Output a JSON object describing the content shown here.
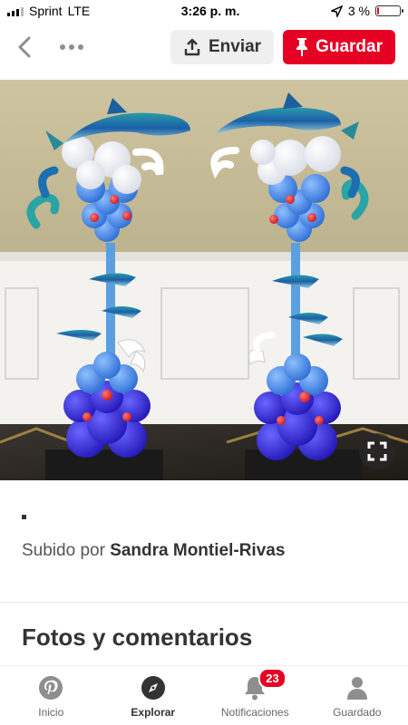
{
  "status_bar": {
    "carrier": "Sprint",
    "network": "LTE",
    "time": "3:26 p. m.",
    "battery_text": "3 %",
    "battery_level": 0.03
  },
  "top_bar": {
    "share_label": "Enviar",
    "save_label": "Guardar"
  },
  "pin": {
    "dot": "·",
    "uploaded_by_prefix": "Subido por",
    "uploader_name": "Sandra Montiel-Rivas",
    "comments_title": "Fotos y comentarios"
  },
  "bottom_nav": {
    "items": [
      {
        "label": "Inicio",
        "icon": "pinterest-icon"
      },
      {
        "label": "Explorar",
        "icon": "compass-icon"
      },
      {
        "label": "Notificaciones",
        "icon": "bell-icon",
        "badge": "23"
      },
      {
        "label": "Guardado",
        "icon": "person-icon"
      }
    ]
  },
  "colors": {
    "brand_red": "#e60023",
    "share_bg": "#efefef"
  }
}
